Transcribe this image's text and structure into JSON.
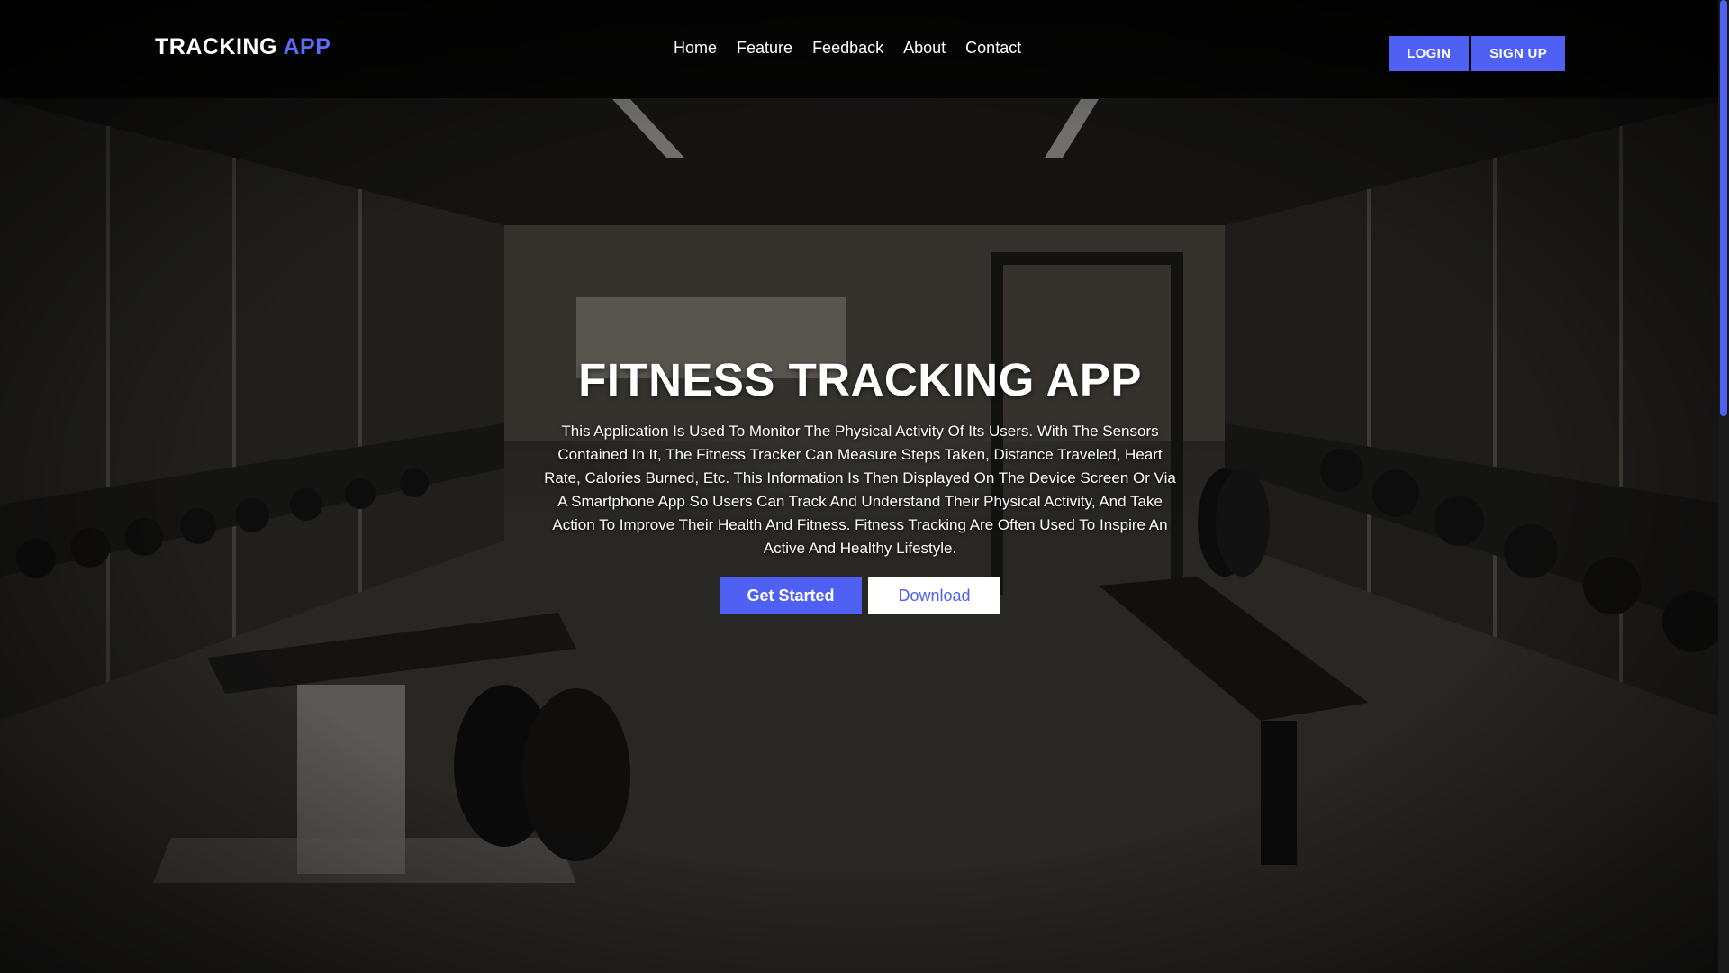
{
  "colors": {
    "accent": "#4e61f2",
    "header_bg": "rgba(0,0,0,0.72)",
    "text": "#ffffff"
  },
  "header": {
    "logo_main": "TRACKING",
    "logo_accent": "APP",
    "nav": [
      "Home",
      "Feature",
      "Feedback",
      "About",
      "Contact"
    ],
    "login_label": "LOGIN",
    "signup_label": "SIGN UP"
  },
  "hero": {
    "title": "FITNESS TRACKING APP",
    "description": "This Application Is Used To Monitor The Physical Activity Of Its Users. With The Sensors Contained In It, The Fitness Tracker Can Measure Steps Taken, Distance Traveled, Heart Rate, Calories Burned, Etc. This Information Is Then Displayed On The Device Screen Or Via A Smartphone App So Users Can Track And Understand Their Physical Activity, And Take Action To Improve Their Health And Fitness. Fitness Tracking Are Often Used To Inspire An Active And Healthy Lifestyle.",
    "primary_label": "Get Started",
    "secondary_label": "Download"
  }
}
